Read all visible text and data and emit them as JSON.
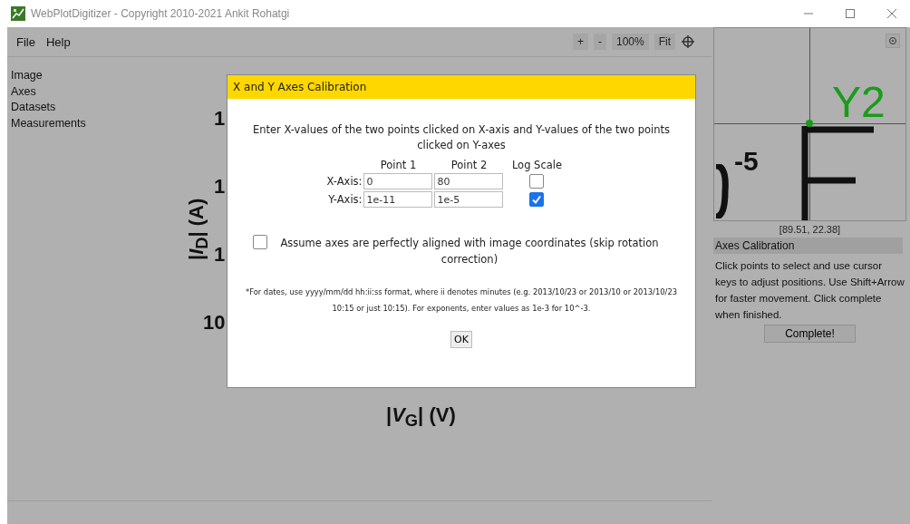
{
  "window": {
    "title": "WebPlotDigitizer - Copyright 2010-2021 Ankit Rohatgi"
  },
  "menu": [
    {
      "label": "File"
    },
    {
      "label": "Help"
    }
  ],
  "zoom_toolbar": [
    {
      "label": "+"
    },
    {
      "label": "-"
    },
    {
      "label": "100%"
    },
    {
      "label": "Fit"
    }
  ],
  "sidebar": {
    "items": [
      {
        "label": "Image"
      },
      {
        "label": "Axes"
      },
      {
        "label": "Datasets"
      },
      {
        "label": "Measurements"
      }
    ]
  },
  "plot_image": {
    "tick_labels": [
      "1",
      "1",
      "1",
      "10"
    ],
    "ylabel": "|*I*$_{D}$| (A)",
    "xlabel": "|*V*$_{G}$| (V)"
  },
  "magnifier": {
    "tick_label": "-5",
    "point_label": "Y2",
    "coordinates": "[89.51, 22.38]"
  },
  "panel": {
    "title": "Axes Calibration",
    "instructions": "Click points to select and use cursor keys to adjust positions. Use Shift+Arrow for faster movement. Click complete when finished.",
    "button": "Complete!"
  },
  "dialog": {
    "title": "X and Y Axes Calibration",
    "instructions": "Enter X-values of the two points clicked on X-axis and Y-values of the two points clicked on Y-axes",
    "columns": [
      "Point 1",
      "Point 2",
      "Log Scale"
    ],
    "rows": [
      {
        "label": "X-Axis:",
        "point_1": "0",
        "point_2": "80",
        "log_scale": false
      },
      {
        "label": "Y-Axis:",
        "point_1": "1e-11",
        "point_2": "1e-5",
        "log_scale": true
      }
    ],
    "align_option": {
      "label": "Assume axes are perfectly aligned with image coordinates (skip rotation correction)",
      "checked": false
    },
    "note": "*For dates, use yyyy/mm/dd hh:ii:ss format, where ii denotes minutes (e.g. 2013/10/23 or 2013/10 or 2013/10/23 10:15 or just 10:15). For exponents, enter values as 1e-3 for 10^-3.",
    "ok_button": "OK"
  }
}
